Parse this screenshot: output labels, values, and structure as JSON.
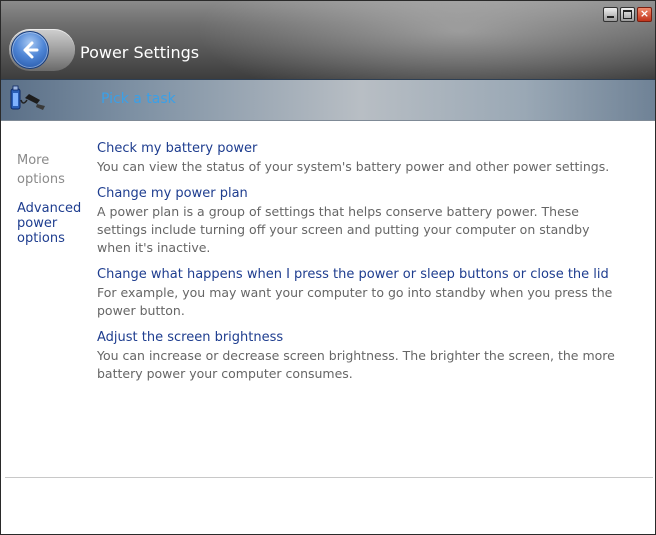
{
  "window": {
    "title": "Power Settings"
  },
  "taskbar": {
    "link_label": "Pick a task"
  },
  "sidebar": {
    "more_options_label": "More options",
    "advanced_label": "Advanced power options"
  },
  "tasks": [
    {
      "title": "Check my battery power",
      "description": "You can view the status of your system's battery power and other power settings."
    },
    {
      "title": "Change my power plan",
      "description": "A power plan is a group of settings that helps conserve battery power. These settings include turning off your screen and putting your computer on standby when it's inactive."
    },
    {
      "title": "Change what happens when I press the power or sleep buttons or close the lid",
      "description": "For example, you may want your computer to go into standby when you press the power button."
    },
    {
      "title": "Adjust the screen brightness",
      "description": "You can increase or decrease screen brightness. The brighter the screen, the more battery power your computer consumes."
    }
  ],
  "colors": {
    "link": "#1e3d8f",
    "task_link": "#3aa0e8",
    "description": "#666666"
  }
}
